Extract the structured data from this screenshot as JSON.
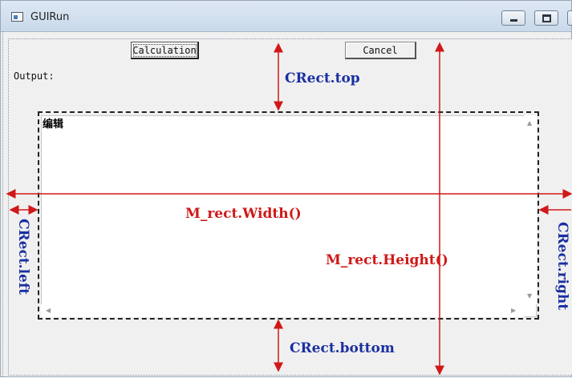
{
  "window": {
    "title": "GUIRun"
  },
  "buttons": {
    "calculation": "Calculation",
    "cancel": "Cancel"
  },
  "output": {
    "label": "Output:"
  },
  "edit": {
    "text": "编辑"
  },
  "annotations": {
    "top": "CRect.top",
    "left": "CRect.left",
    "right": "CRect.right",
    "bottom": "CRect.bottom",
    "width": "M_rect.Width()",
    "height": "M_rect.Height()"
  },
  "icons": {
    "minimize": "minimize-icon",
    "maximize": "maximize-icon",
    "app": "app-window-icon",
    "scroll_up": "scroll-up-arrow-icon",
    "scroll_down": "scroll-down-arrow-icon",
    "scroll_left": "scroll-left-arrow-icon",
    "scroll_right": "scroll-right-arrow-icon"
  },
  "colors": {
    "annotation_blue": "#1a2fa0",
    "annotation_red": "#d01818"
  }
}
